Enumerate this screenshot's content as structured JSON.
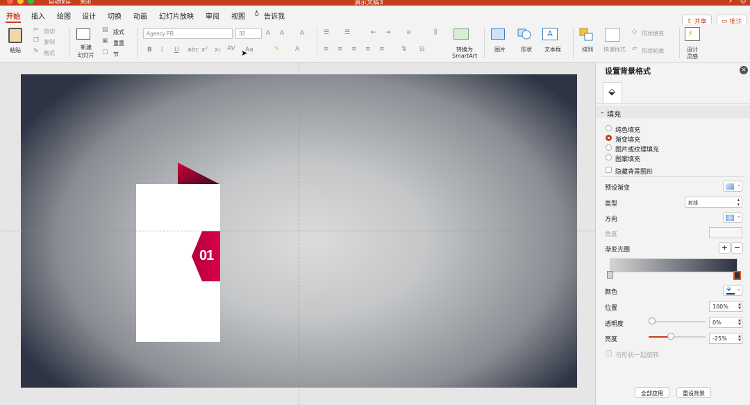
{
  "titlebar": {
    "title": "演示文稿3",
    "autosave": "自动保存",
    "autosave_state": "关闭"
  },
  "tabs": [
    "开始",
    "插入",
    "绘图",
    "设计",
    "切换",
    "动画",
    "幻灯片放映",
    "审阅",
    "视图",
    "告诉我"
  ],
  "actions": {
    "share": "共享",
    "comment": "批注"
  },
  "ribbon": {
    "paste": "粘贴",
    "cut": "剪切",
    "copy": "复制",
    "format": "格式",
    "new_slide_line1": "新建",
    "new_slide_line2": "幻灯片",
    "layout": "版式",
    "reset": "重置",
    "section": "节",
    "font_name": "Agency FB",
    "font_size": "32",
    "convert_line1": "转换为",
    "convert_line2": "SmartArt",
    "picture": "图片",
    "shape": "形状",
    "textbox": "文本框",
    "arrange": "排列",
    "quick_styles": "快速样式",
    "shape_fill": "形状填充",
    "shape_outline": "形状轮廓",
    "designer_line1": "设计",
    "designer_line2": "灵感"
  },
  "slide": {
    "badge_text": "01",
    "accent_color": "#c8003c",
    "accent_dark": "#3a0a1c",
    "card_color": "#ffffff"
  },
  "panel": {
    "title": "设置背景格式",
    "section": "填充",
    "fill_options": [
      "纯色填充",
      "渐变填充",
      "图片或纹理填充",
      "图案填充"
    ],
    "selected_fill": "渐变填充",
    "hide_bg_graphics": "隐藏背景图形",
    "preset_gradient": "预设渐变",
    "type_label": "类型",
    "type_value": "射线",
    "direction": "方向",
    "angle": "角度",
    "gradient_stops": "渐变光圈",
    "color": "颜色",
    "position_label": "位置",
    "position_value": "100%",
    "transparency_label": "透明度",
    "transparency_value": "0%",
    "transparency_fraction": 0.0,
    "brightness_label": "亮度",
    "brightness_value": "-25%",
    "brightness_fraction": 0.375,
    "rotate_with_shape": "与形状一起旋转",
    "apply_all": "全部应用",
    "reset_background": "重设背景"
  },
  "colors": {
    "brand": "#c43e1c",
    "gradient_start": "#d4d4d4",
    "gradient_end": "#2c3240"
  }
}
